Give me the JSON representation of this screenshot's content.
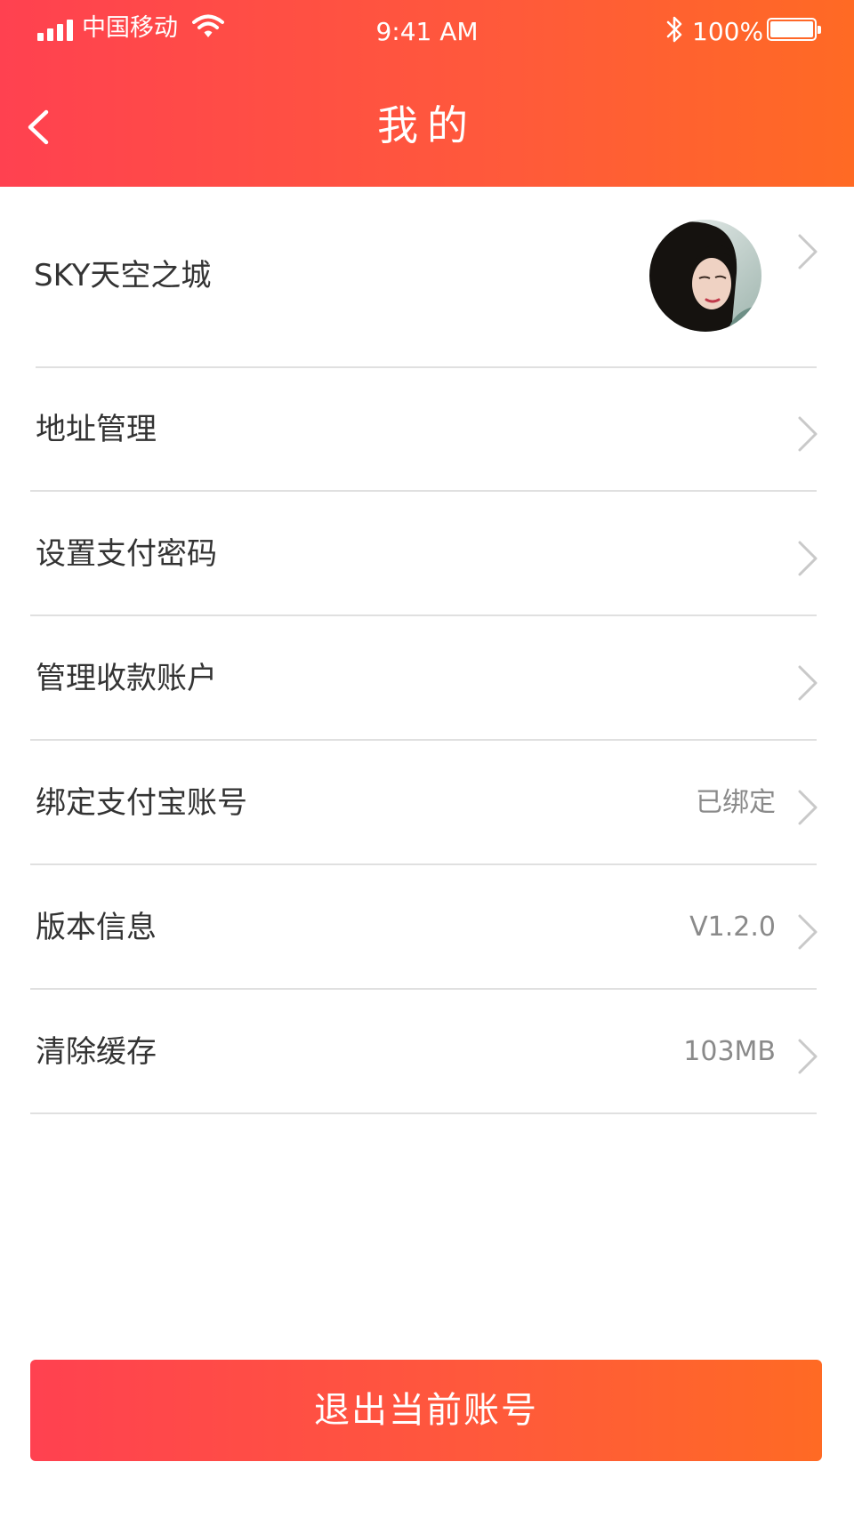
{
  "status_bar": {
    "carrier": "中国移动",
    "time": "9:41 AM",
    "battery": "100%",
    "icons": [
      "signal-icon",
      "wifi-icon",
      "bluetooth-icon",
      "battery-icon"
    ]
  },
  "nav": {
    "title": "我的",
    "back_icon": "back-arrow-icon"
  },
  "profile": {
    "name": "SKY天空之城",
    "avatar_icon": "avatar-photo"
  },
  "menu": {
    "items": [
      {
        "label": "地址管理",
        "value": ""
      },
      {
        "label": "设置支付密码",
        "value": ""
      },
      {
        "label": "管理收款账户",
        "value": ""
      },
      {
        "label": "绑定支付宝账号",
        "value": "已绑定"
      },
      {
        "label": "版本信息",
        "value": "V1.2.0"
      },
      {
        "label": "清除缓存",
        "value": "103MB"
      }
    ]
  },
  "logout": {
    "label": "退出当前账号"
  },
  "colors": {
    "accent_start": "#ff4150",
    "accent_end": "#ff6a24",
    "text": "#333333",
    "muted": "#8a8a8a",
    "divider": "#e0e0e0"
  }
}
